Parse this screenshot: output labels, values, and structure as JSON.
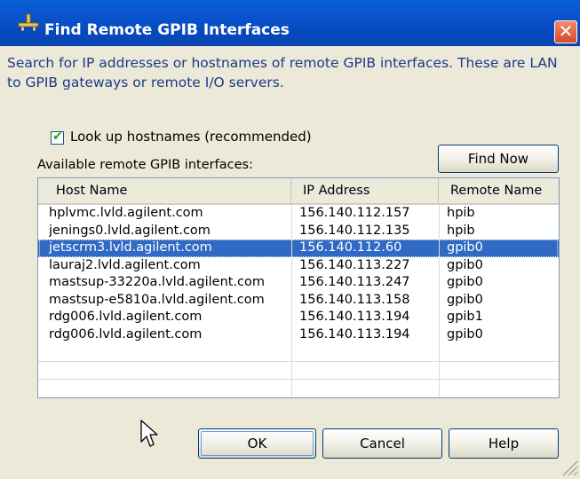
{
  "window": {
    "title": "Find Remote GPIB Interfaces",
    "close_glyph": "✕",
    "icon": "lan-gpib-connector-icon"
  },
  "description": "Search for IP addresses or hostnames of remote GPIB interfaces.  These are LAN to GPIB gateways or remote I/O servers.",
  "lookup_checkbox": {
    "label": "Look up hostnames (recommended)",
    "checked": true
  },
  "available_label": "Available remote GPIB interfaces:",
  "find_now_label": "Find Now",
  "table": {
    "columns": [
      "Host Name",
      "IP Address",
      "Remote Name"
    ],
    "rows": [
      {
        "host": "hplvmc.lvld.agilent.com",
        "ip": "156.140.112.157",
        "remote": "hpib",
        "selected": false
      },
      {
        "host": "jenings0.lvld.agilent.com",
        "ip": "156.140.112.135",
        "remote": "hpib",
        "selected": false
      },
      {
        "host": "jetscrm3.lvld.agilent.com",
        "ip": "156.140.112.60",
        "remote": "gpib0",
        "selected": true
      },
      {
        "host": "lauraj2.lvld.agilent.com",
        "ip": "156.140.113.227",
        "remote": "gpib0",
        "selected": false
      },
      {
        "host": "mastsup-33220a.lvld.agilent.com",
        "ip": "156.140.113.247",
        "remote": "gpib0",
        "selected": false
      },
      {
        "host": "mastsup-e5810a.lvld.agilent.com",
        "ip": "156.140.113.158",
        "remote": "gpib0",
        "selected": false
      },
      {
        "host": "rdg006.lvld.agilent.com",
        "ip": "156.140.113.194",
        "remote": "gpib1",
        "selected": false
      },
      {
        "host": "rdg006.lvld.agilent.com",
        "ip": "156.140.113.194",
        "remote": "gpib0",
        "selected": false
      }
    ]
  },
  "buttons": {
    "ok": "OK",
    "cancel": "Cancel",
    "help": "Help"
  },
  "colors": {
    "titlebar": "#0a53cd",
    "dialog_bg": "#ece9d8",
    "selection": "#316ac5",
    "description_text": "#1c3a8a"
  }
}
